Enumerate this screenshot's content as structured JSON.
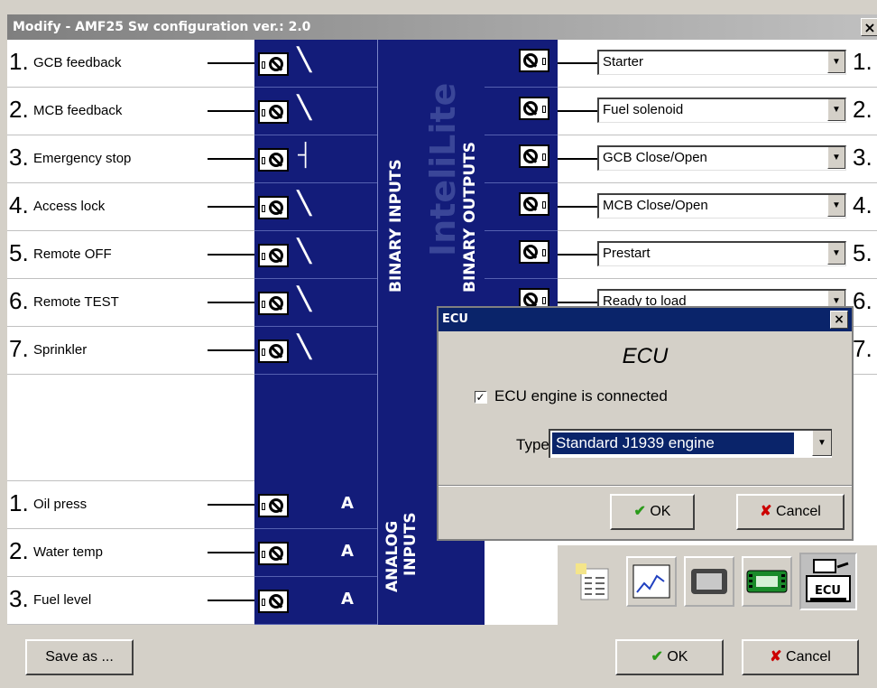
{
  "window": {
    "title": "Modify - AMF25  Sw configuration ver.: 2.0",
    "close_glyph": "×"
  },
  "binary_inputs": [
    {
      "num": "1.",
      "label": "GCB feedback",
      "switch": "NO"
    },
    {
      "num": "2.",
      "label": "MCB feedback",
      "switch": "NO"
    },
    {
      "num": "3.",
      "label": "Emergency stop",
      "switch": "NC"
    },
    {
      "num": "4.",
      "label": "Access lock",
      "switch": "NO"
    },
    {
      "num": "5.",
      "label": "Remote OFF",
      "switch": "NO"
    },
    {
      "num": "6.",
      "label": "Remote TEST",
      "switch": "NO"
    },
    {
      "num": "7.",
      "label": "Sprinkler",
      "switch": "NO"
    }
  ],
  "analog_inputs": [
    {
      "num": "1.",
      "label": "Oil press",
      "letter": "A"
    },
    {
      "num": "2.",
      "label": "Water temp",
      "letter": "A"
    },
    {
      "num": "3.",
      "label": "Fuel level",
      "letter": "A"
    }
  ],
  "binary_outputs": [
    {
      "num": "1.",
      "value": "Starter"
    },
    {
      "num": "2.",
      "value": "Fuel solenoid"
    },
    {
      "num": "3.",
      "value": "GCB Close/Open"
    },
    {
      "num": "4.",
      "value": "MCB Close/Open"
    },
    {
      "num": "5.",
      "value": "Prestart"
    },
    {
      "num": "6.",
      "value": "Ready to load"
    },
    {
      "num": "7.",
      "value": ""
    }
  ],
  "panel_labels": {
    "binary_inputs": "BINARY INPUTS",
    "binary_outputs": "BINARY OUTPUTS",
    "analog_line1": "ANALOG",
    "analog_line2": "INPUTS",
    "brand": "InteliLite"
  },
  "ecu_dialog": {
    "titlebar": "ECU",
    "close_glyph": "×",
    "heading": "ECU",
    "checkbox_label": "ECU engine is connected",
    "checkbox_checked": true,
    "type_label": "Type:",
    "type_value": "Standard J1939 engine",
    "ok": "OK",
    "cancel": "Cancel"
  },
  "toolbar_icons": [
    "list-icon",
    "chart-icon",
    "display-icon",
    "module-icon",
    "ecu-icon"
  ],
  "ecu_icon_text": "ECU",
  "footer": {
    "save_as": "Save as ...",
    "ok": "OK",
    "cancel": "Cancel"
  },
  "colors": {
    "panel_blue": "#131c7a",
    "title_gray": "#8a8a8a",
    "dialog_title": "#0a246a",
    "ok_check": "#2a9a1a",
    "cancel_x": "#cc0000"
  }
}
